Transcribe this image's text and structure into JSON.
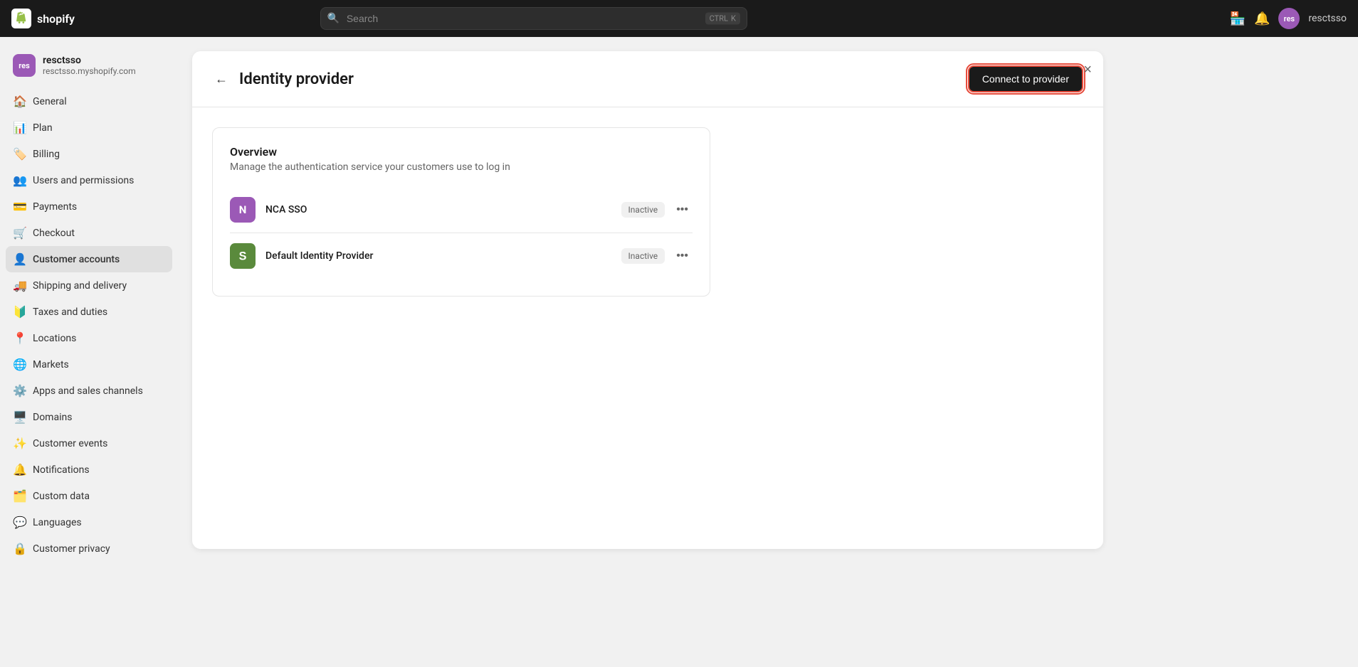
{
  "topnav": {
    "logo_text": "shopify",
    "search_placeholder": "Search",
    "shortcut_key1": "CTRL",
    "shortcut_key2": "K",
    "username": "resctsso",
    "avatar_initials": "res"
  },
  "sidebar": {
    "store_name": "resctsso",
    "store_url": "resctsso.myshopify.com",
    "store_initials": "res",
    "nav_items": [
      {
        "id": "general",
        "label": "General",
        "icon": "🏠"
      },
      {
        "id": "plan",
        "label": "Plan",
        "icon": "📊"
      },
      {
        "id": "billing",
        "label": "Billing",
        "icon": "🏷️"
      },
      {
        "id": "users",
        "label": "Users and permissions",
        "icon": "👥"
      },
      {
        "id": "payments",
        "label": "Payments",
        "icon": "💳"
      },
      {
        "id": "checkout",
        "label": "Checkout",
        "icon": "🛒"
      },
      {
        "id": "customer-accounts",
        "label": "Customer accounts",
        "icon": "👤"
      },
      {
        "id": "shipping",
        "label": "Shipping and delivery",
        "icon": "🚚"
      },
      {
        "id": "taxes",
        "label": "Taxes and duties",
        "icon": "🔰"
      },
      {
        "id": "locations",
        "label": "Locations",
        "icon": "📍"
      },
      {
        "id": "markets",
        "label": "Markets",
        "icon": "🌐"
      },
      {
        "id": "apps",
        "label": "Apps and sales channels",
        "icon": "⚙️"
      },
      {
        "id": "domains",
        "label": "Domains",
        "icon": "🖥️"
      },
      {
        "id": "customer-events",
        "label": "Customer events",
        "icon": "✨"
      },
      {
        "id": "notifications",
        "label": "Notifications",
        "icon": "🔔"
      },
      {
        "id": "custom-data",
        "label": "Custom data",
        "icon": "🗂️"
      },
      {
        "id": "languages",
        "label": "Languages",
        "icon": "💬"
      },
      {
        "id": "customer-privacy",
        "label": "Customer privacy",
        "icon": "🔒"
      }
    ]
  },
  "panel": {
    "back_label": "←",
    "title": "Identity provider",
    "connect_btn_label": "Connect to provider",
    "close_label": "×",
    "overview": {
      "title": "Overview",
      "description": "Manage the authentication service your customers use to log in"
    },
    "providers": [
      {
        "id": "nca-sso",
        "name": "NCA SSO",
        "icon_type": "nca",
        "icon_letter": "N",
        "status": "Inactive"
      },
      {
        "id": "default-idp",
        "name": "Default Identity Provider",
        "icon_type": "shopify",
        "status": "Inactive"
      }
    ]
  }
}
